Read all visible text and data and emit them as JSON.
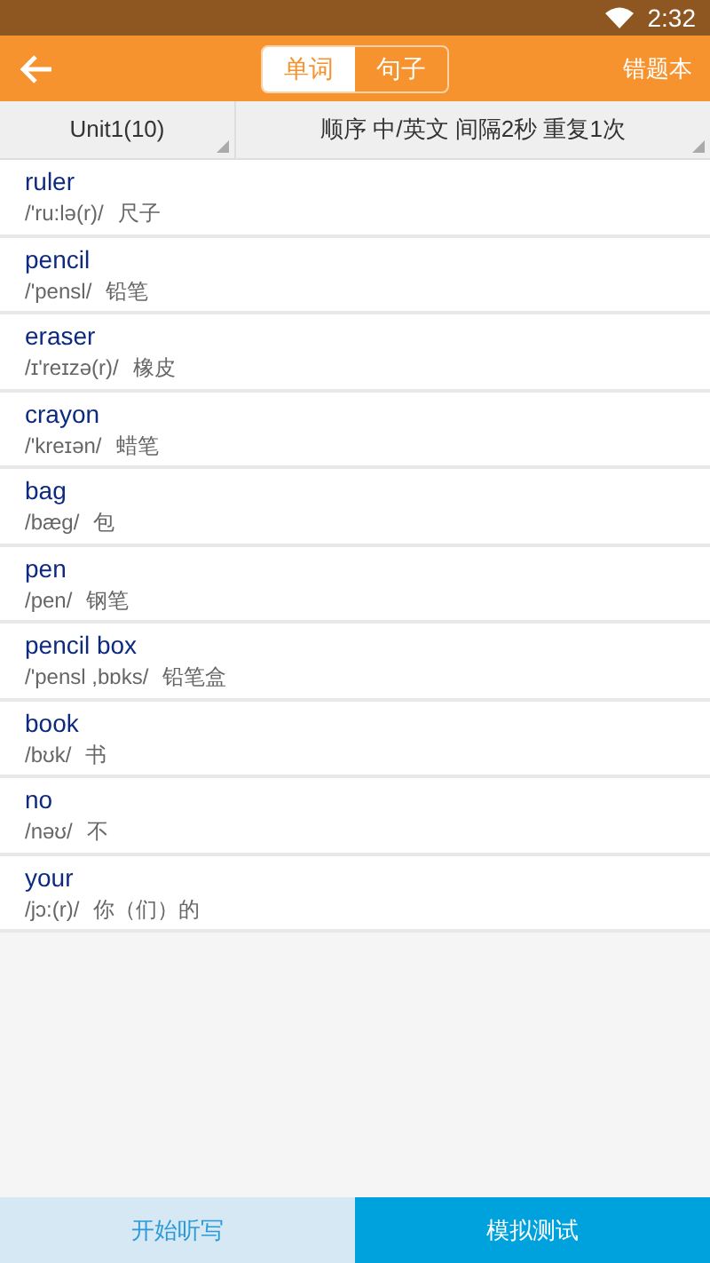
{
  "status_bar": {
    "time": "2:32"
  },
  "header": {
    "tabs": [
      {
        "label": "单词",
        "selected": true
      },
      {
        "label": "句子",
        "selected": false
      }
    ],
    "action": "错题本"
  },
  "filters": [
    "Unit1(10)",
    "顺序 中/英文 间隔2秒 重复1次"
  ],
  "words": [
    {
      "word": "ruler",
      "phonetic": "/'ru:lə(r)/",
      "meaning": "尺子"
    },
    {
      "word": "pencil",
      "phonetic": "/'pensl/",
      "meaning": "铅笔"
    },
    {
      "word": "eraser",
      "phonetic": "/ɪ'reɪzə(r)/",
      "meaning": "橡皮"
    },
    {
      "word": "crayon",
      "phonetic": "/'kreɪən/",
      "meaning": "蜡笔"
    },
    {
      "word": "bag",
      "phonetic": "/bæg/",
      "meaning": "包"
    },
    {
      "word": "pen",
      "phonetic": "/pen/",
      "meaning": "钢笔"
    },
    {
      "word": "pencil box",
      "phonetic": "/'pensl ,bɒks/",
      "meaning": "铅笔盒"
    },
    {
      "word": "book",
      "phonetic": "/bʊk/",
      "meaning": "书"
    },
    {
      "word": "no",
      "phonetic": "/nəʊ/",
      "meaning": "不"
    },
    {
      "word": "your",
      "phonetic": "/jɔ:(r)/",
      "meaning": "你（们）的"
    }
  ],
  "buttons": [
    {
      "label": "开始听写",
      "kind": "secondary"
    },
    {
      "label": "模拟测试",
      "kind": "primary"
    }
  ]
}
